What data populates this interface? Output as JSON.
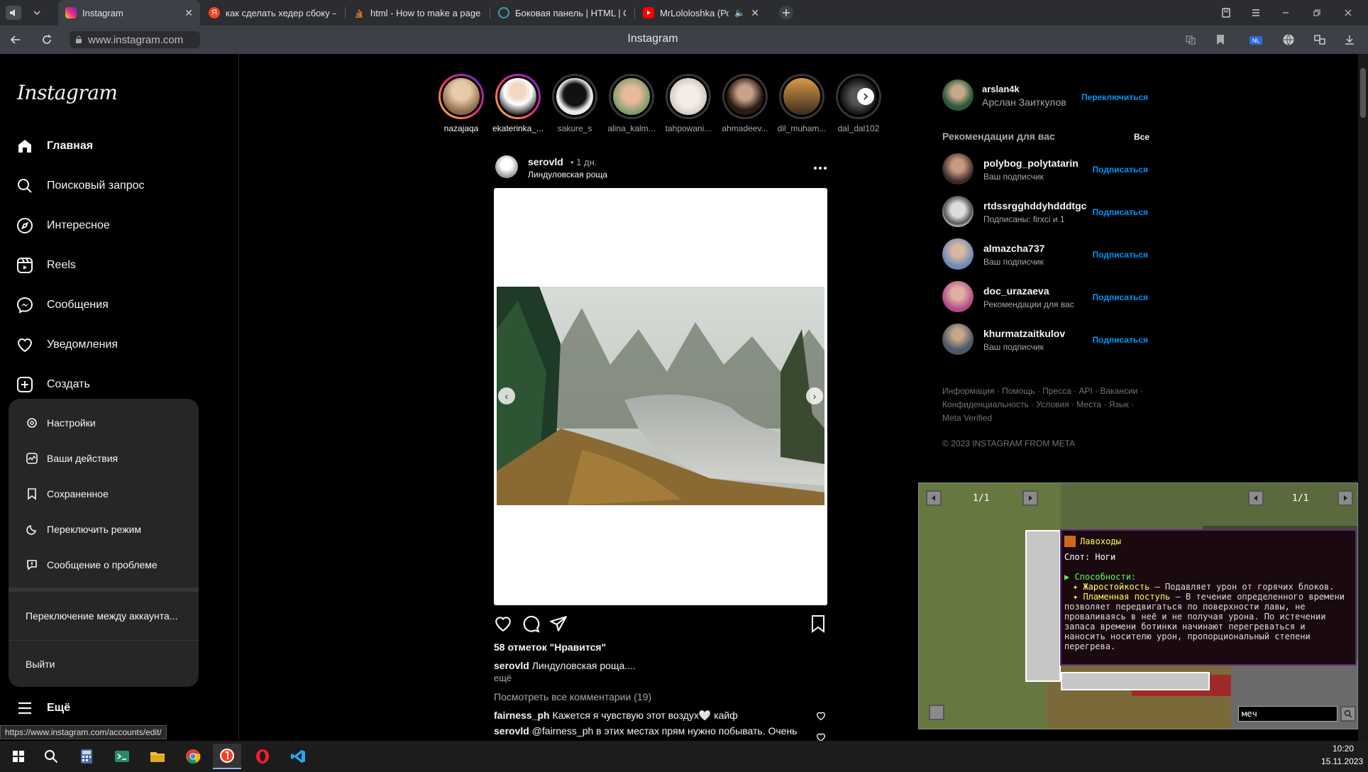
{
  "browser": {
    "tabs": [
      {
        "title": "Instagram",
        "active": true,
        "favicon": "instagram-icon",
        "color": "#e1306c"
      },
      {
        "title": "как сделать хедер сбоку –",
        "favicon": "yandex-icon",
        "color": "#fc3f1d"
      },
      {
        "title": "html - How to make a page",
        "favicon": "stackoverflow-icon",
        "color": "#f48024"
      },
      {
        "title": "Боковая панель | HTML | C",
        "favicon": "site-icon",
        "color": "#3d9bb0"
      },
      {
        "title": "MrLololoshka (Роман",
        "favicon": "youtube-icon",
        "color": "#ff0000"
      }
    ],
    "url": "www.instagram.com",
    "page_title": "Instagram",
    "status_url": "https://www.instagram.com/accounts/edit/"
  },
  "nav": {
    "logo": "Instagram",
    "items": [
      {
        "label": "Главная",
        "icon": "home-icon",
        "bold": true
      },
      {
        "label": "Поисковый запрос",
        "icon": "search-icon"
      },
      {
        "label": "Интересное",
        "icon": "compass-icon"
      },
      {
        "label": "Reels",
        "icon": "reels-icon"
      },
      {
        "label": "Сообщения",
        "icon": "messenger-icon"
      },
      {
        "label": "Уведомления",
        "icon": "heart-icon"
      },
      {
        "label": "Создать",
        "icon": "create-icon"
      }
    ],
    "more_label": "Ещё",
    "menu": {
      "items": [
        {
          "label": "Настройки",
          "icon": "settings-icon"
        },
        {
          "label": "Ваши действия",
          "icon": "activity-icon"
        },
        {
          "label": "Сохраненное",
          "icon": "bookmark-icon"
        },
        {
          "label": "Переключить режим",
          "icon": "moon-icon"
        },
        {
          "label": "Сообщение о проблеме",
          "icon": "report-icon"
        }
      ],
      "switch_accounts": "Переключение между аккаунта...",
      "logout": "Выйти"
    }
  },
  "stories": [
    {
      "name": "nazajaqa",
      "seen": false
    },
    {
      "name": "ekaterinka_...",
      "seen": false
    },
    {
      "name": "sakure_s",
      "seen": true
    },
    {
      "name": "alina_kalm...",
      "seen": true
    },
    {
      "name": "tahpowani...",
      "seen": true
    },
    {
      "name": "ahmadeev...",
      "seen": true
    },
    {
      "name": "dil_muham...",
      "seen": true
    },
    {
      "name": "dal_dal102",
      "seen": true
    }
  ],
  "post": {
    "username": "serovld",
    "time": "• 1 дн.",
    "location": "Линдуловская роща",
    "likes": "58 отметок \"Нравится\"",
    "caption_user": "serovld",
    "caption_text": "Линдуловская роща....",
    "more": "ещё",
    "view_comments": "Посмотреть все комментарии (19)",
    "comments": [
      {
        "user": "fairness_ph",
        "text": "Кажется я чувствую этот воздух🤍 кайф"
      },
      {
        "user": "serovld",
        "text": "@fairness_ph в этих местах прям нужно побывать. Очень"
      }
    ]
  },
  "sidebar": {
    "user": {
      "username": "arslan4k",
      "fullname": "Арслан Заиткулов",
      "switch": "Переключиться"
    },
    "suggestions_title": "Рекомендации для вас",
    "see_all": "Все",
    "suggestions": [
      {
        "username": "polybog_polytatarin",
        "sub": "Ваш подписчик",
        "action": "Подписаться"
      },
      {
        "username": "rtdssrgghddyhdddtgc",
        "sub": "Подписаны: firxci и 1",
        "action": "Подписаться"
      },
      {
        "username": "almazcha737",
        "sub": "Ваш подписчик",
        "action": "Подписаться"
      },
      {
        "username": "doc_urazaeva",
        "sub": "Рекомендации для вас",
        "action": "Подписаться"
      },
      {
        "username": "khurmatzaitkulov",
        "sub": "Ваш подписчик",
        "action": "Подписаться"
      }
    ],
    "footer_line1": "Информация · Помощь · Пресса · API · Вакансии ·",
    "footer_line2": "Конфиденциальность · Условия · Места · Язык ·",
    "footer_line3": "Meta Verified",
    "copyright": "© 2023 INSTAGRAM FROM META"
  },
  "game": {
    "page_left": "1/1",
    "page_right": "1/1",
    "item_name": "Лавоходы",
    "slot": "Слот: Ноги",
    "abilities_title": "▶ Способности:",
    "ability1_name": "✦ Жаростойкость",
    "ability1_text": " – Подавляет урон от горячих блоков.",
    "ability2_name": "✦ Пламенная поступь",
    "ability2_text": " – В течение определенного времени",
    "desc_lines": [
      "позволяет передвигаться по поверхности лавы, не",
      "проваливаясь в неё и не получая урона. По истечении",
      "запаса времени ботинки начинают перегреваться и",
      "наносить носителю урон, пропорциональный степени",
      "перегрева."
    ],
    "search_value": "меч"
  },
  "taskbar": {
    "time": "10:20",
    "date": "15.11.2023"
  }
}
